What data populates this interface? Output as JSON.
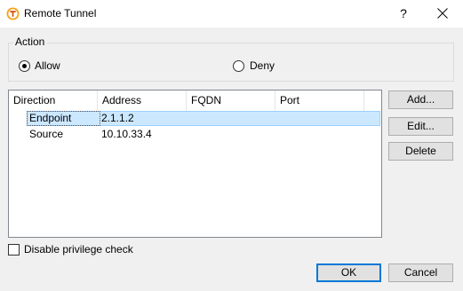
{
  "window": {
    "title": "Remote Tunnel",
    "help_glyph": "?",
    "accent_color": "#0078d7",
    "selection_color": "#cce8ff",
    "app_icon_color": "#f7a21b"
  },
  "action": {
    "legend": "Action",
    "options": [
      {
        "label": "Allow",
        "selected": true
      },
      {
        "label": "Deny",
        "selected": false
      }
    ]
  },
  "table": {
    "columns": [
      "Direction",
      "Address",
      "FQDN",
      "Port"
    ],
    "rows": [
      {
        "direction": "Endpoint",
        "address": "2.1.1.2",
        "fqdn": "",
        "port": "",
        "selected": true
      },
      {
        "direction": "Source",
        "address": "10.10.33.4",
        "fqdn": "",
        "port": "",
        "selected": false
      }
    ]
  },
  "side_buttons": {
    "add": "Add...",
    "edit": "Edit...",
    "delete": "Delete"
  },
  "options": {
    "disable_privilege_check": {
      "label": "Disable privilege check",
      "checked": false
    }
  },
  "footer": {
    "ok": "OK",
    "cancel": "Cancel"
  }
}
